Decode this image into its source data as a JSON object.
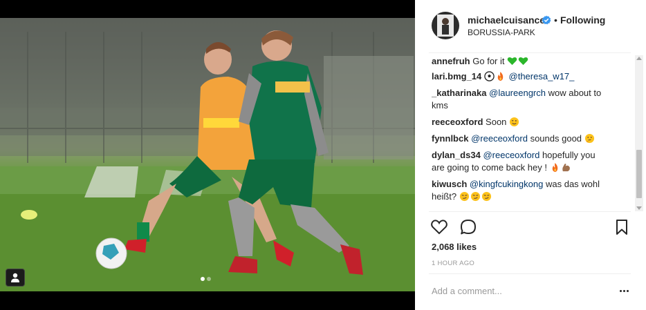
{
  "post": {
    "username": "michaelcuisance",
    "separator": "•",
    "follow_status": "Following",
    "location": "BORUSSIA-PARK"
  },
  "comments": [
    {
      "user": "annefruh",
      "text": "Go for it",
      "emojis": [
        "green-heart-icon",
        "green-heart-icon"
      ]
    },
    {
      "user": "lari.bmg_14",
      "emojis": [
        "soccer-ball-icon",
        "fire-icon"
      ],
      "mention": "@theresa_w17_"
    },
    {
      "user": "_katharinaka",
      "mention": "@laureengrch",
      "text_line1": "wow about to",
      "text_line2": "kms"
    },
    {
      "user": "reeceoxford",
      "text": "Soon",
      "emojis": [
        "winking-face-icon"
      ]
    },
    {
      "user": "fynnlbck",
      "mention": "@reeceoxford",
      "text": "sounds good",
      "emojis": [
        "thinking-face-icon"
      ]
    },
    {
      "user": "dylan_ds34",
      "mention": "@reeceoxford",
      "text_line1": "hopefully you",
      "text_line2": "are going to come back hey !",
      "emojis": [
        "fire-icon",
        "flexed-biceps-icon"
      ]
    },
    {
      "user": "kiwusch",
      "mention": "@kingfcukingkong",
      "text_line1": "was das wohl",
      "text_line2": "heißt?",
      "emojis": [
        "smirking-face-icon",
        "smirking-face-icon",
        "smirking-face-icon"
      ]
    }
  ],
  "likes": "2,068 likes",
  "time": "1 HOUR AGO",
  "add_comment_placeholder": "Add a comment...",
  "icons": {
    "like": "heart-outline-icon",
    "comment": "speech-bubble-icon",
    "save": "bookmark-icon",
    "more": "ellipsis-icon",
    "verified": "verified-badge-icon",
    "user_tag": "person-tag-icon"
  },
  "colors": {
    "link": "#003569",
    "verified": "#3897f0",
    "muted": "#999999",
    "text": "#262626"
  },
  "carousel": {
    "slide_count": 2,
    "active_index": 1
  }
}
